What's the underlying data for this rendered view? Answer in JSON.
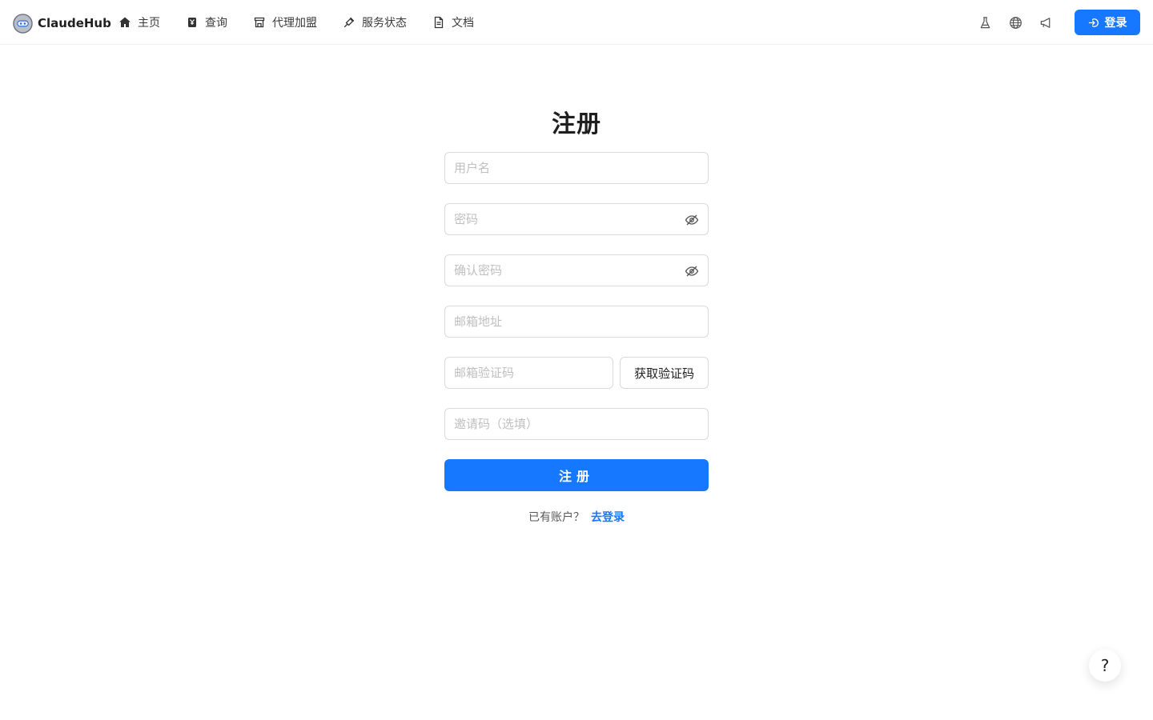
{
  "brand": {
    "name": "ClaudeHub"
  },
  "nav": {
    "items": [
      {
        "label": "主页",
        "icon": "home-icon"
      },
      {
        "label": "查询",
        "icon": "search-ticket-icon"
      },
      {
        "label": "代理加盟",
        "icon": "store-icon"
      },
      {
        "label": "服务状态",
        "icon": "pulse-icon"
      },
      {
        "label": "文档",
        "icon": "document-icon"
      }
    ]
  },
  "toolbar": {
    "icons": [
      "flask-icon",
      "globe-icon",
      "megaphone-icon"
    ],
    "login_label": "登录"
  },
  "form": {
    "title": "注册",
    "username_placeholder": "用户名",
    "password_placeholder": "密码",
    "confirm_placeholder": "确认密码",
    "email_placeholder": "邮箱地址",
    "code_placeholder": "邮箱验证码",
    "code_button": "获取验证码",
    "invite_placeholder": "邀请码（选填）",
    "submit_label": "注册",
    "has_account_text": "已有账户？",
    "login_link": "去登录"
  },
  "help": {
    "label": "?"
  },
  "colors": {
    "primary": "#1677ff",
    "border": "#d9d9d9",
    "placeholder": "#bfbfbf"
  }
}
